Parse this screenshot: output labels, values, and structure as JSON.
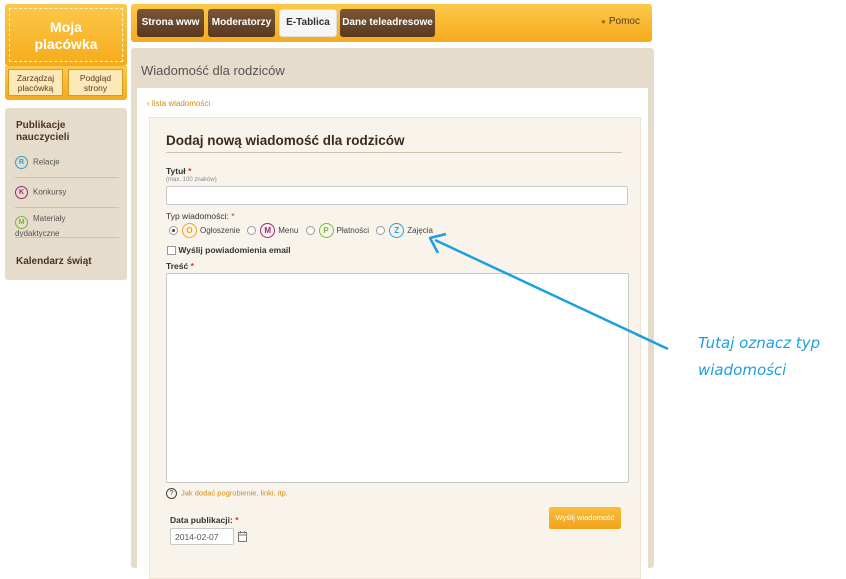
{
  "logo": {
    "title_line1": "Moja",
    "title_line2": "placówka"
  },
  "logo_buttons": {
    "manage": "Zarządzaj placówką",
    "preview": "Podgląd strony"
  },
  "topnav": {
    "items": [
      "Strona www",
      "Moderatorzy",
      "E-Tablica",
      "Dane teleadresowe"
    ],
    "active": "E-Tablica",
    "help": "Pomoc"
  },
  "sidebar": {
    "section_title": "Publikacje nauczycieli",
    "items": [
      {
        "letter": "R",
        "label": "Relacje",
        "color": "#2a9fd8"
      },
      {
        "letter": "K",
        "label": "Konkursy",
        "color": "#a0247f"
      },
      {
        "letter": "M",
        "label": "Materiały dydaktyczne",
        "color": "#7ab83a"
      }
    ],
    "calendar": "Kalendarz świąt"
  },
  "main": {
    "title": "Wiadomość dla rodziców",
    "back_link": "‹ lista wiadomości",
    "form": {
      "heading": "Dodaj nową wiadomość dla rodziców",
      "title_label": "Tytuł",
      "required_mark": "*",
      "title_hint": "(max. 100 znaków)",
      "type_label": "Typ wiadomości:",
      "types": [
        {
          "letter": "O",
          "label": "Ogłoszenie",
          "color": "#f2a21c",
          "selected": true
        },
        {
          "letter": "M",
          "label": "Menu",
          "color": "#a0247f",
          "selected": false
        },
        {
          "letter": "P",
          "label": "Płatności",
          "color": "#7ab83a",
          "selected": false
        },
        {
          "letter": "Z",
          "label": "Zajęcia",
          "color": "#2a9fd8",
          "selected": false
        }
      ],
      "email_checkbox": "Wyślij powiadomienia email",
      "content_label": "Treść",
      "help_link": "Jak dodać pogrubienie, linki, itp.",
      "date_label": "Data publikacji:",
      "date_value": "2014-02-07",
      "submit": "Wyślij wiadomość"
    }
  },
  "annotation": {
    "line1": "Tutaj oznacz typ",
    "line2": "wiadomości",
    "color": "#1e9fe0"
  }
}
